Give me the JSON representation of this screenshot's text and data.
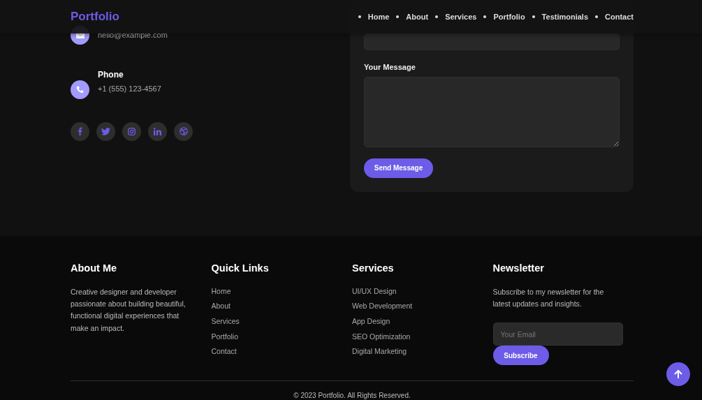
{
  "header": {
    "logo": "Portfolio",
    "nav": [
      {
        "label": "Home"
      },
      {
        "label": "About"
      },
      {
        "label": "Services"
      },
      {
        "label": "Portfolio"
      },
      {
        "label": "Testimonials"
      },
      {
        "label": "Contact"
      }
    ]
  },
  "contact": {
    "items": [
      {
        "kind": "email",
        "value": "hello@example.com"
      },
      {
        "kind": "phone",
        "label": "Phone",
        "value": "+1 (555) 123-4567"
      }
    ],
    "socials": [
      {
        "kind": "facebook"
      },
      {
        "kind": "twitter"
      },
      {
        "kind": "instagram"
      },
      {
        "kind": "linkedin"
      },
      {
        "kind": "dribbble"
      }
    ],
    "form": {
      "fields": [
        {
          "kind": "input"
        },
        {
          "kind": "textarea",
          "label": "Your Message"
        }
      ],
      "button": "Send Message"
    }
  },
  "footer": {
    "about": {
      "title": "About Me",
      "text": "Creative designer and developer passionate about building beautiful, functional digital experiences that make an impact."
    },
    "quick_links": {
      "title": "Quick Links",
      "items": [
        "Home",
        "About",
        "Services",
        "Portfolio",
        "Contact"
      ]
    },
    "services": {
      "title": "Services",
      "items": [
        "UI/UX Design",
        "Web Development",
        "App Design",
        "SEO Optimization",
        "Digital Marketing"
      ]
    },
    "newsletter": {
      "title": "Newsletter",
      "text": "Subscribe to my newsletter for the latest updates and insights.",
      "placeholder": "Your Email",
      "button": "Subscribe"
    },
    "copyright": "© 2023 Portfolio. All Rights Reserved."
  }
}
